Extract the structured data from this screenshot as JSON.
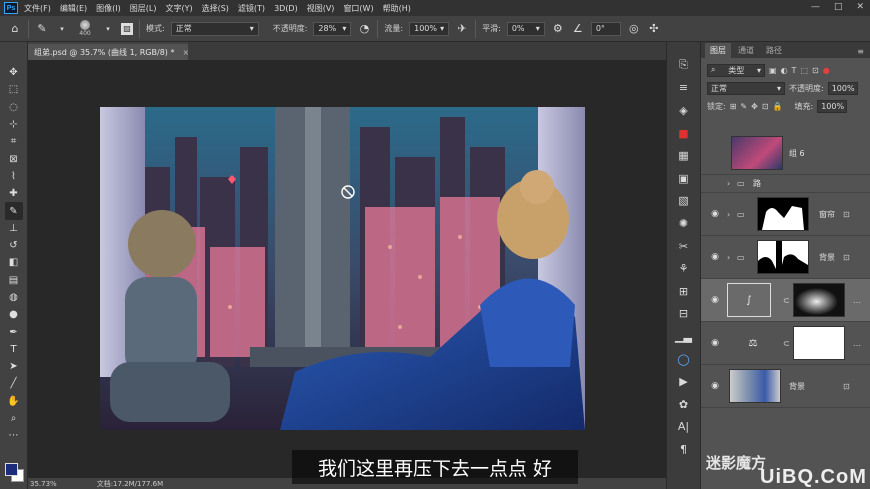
{
  "menu": {
    "logo": "Ps",
    "items": [
      "文件(F)",
      "编辑(E)",
      "图像(I)",
      "图层(L)",
      "文字(Y)",
      "选择(S)",
      "滤镜(T)",
      "3D(D)",
      "视图(V)",
      "窗口(W)",
      "帮助(H)"
    ],
    "window_controls": [
      "—",
      "□",
      "✕"
    ]
  },
  "options": {
    "brush_size": "400",
    "mode_label": "模式:",
    "mode_value": "正常",
    "opacity_label": "不透明度:",
    "opacity_value": "28%",
    "flow_label": "流量:",
    "flow_value": "100%",
    "smooth_label": "平滑:",
    "smooth_value": "0%",
    "angle_value": "0°"
  },
  "document": {
    "tab_title": "组弟.psd @ 35.7% (曲线 1, RGB/8) *",
    "close": "×",
    "zoom": "35.73%",
    "doc_size": "文档:17.2M/177.6M"
  },
  "subtitle": "我们这里再压下去一点点 好",
  "layers_panel": {
    "tabs": [
      "图层",
      "通道",
      "路径"
    ],
    "kind_label": "类型",
    "blend_mode": "正常",
    "opacity_label": "不透明度:",
    "opacity_value": "100%",
    "lock_label": "锁定:",
    "fill_label": "填充:",
    "fill_value": "100%",
    "layers": [
      {
        "name": "组 6"
      },
      {
        "name": "路"
      },
      {
        "name": "窗帘"
      },
      {
        "name": "背景"
      },
      {
        "name": ""
      },
      {
        "name": ""
      },
      {
        "name": "背景"
      }
    ]
  },
  "watermark": {
    "line1": "迷影魔方",
    "line2": "UiBQ.CoM"
  },
  "colors": {
    "foreground": "#1b2c7a",
    "background": "#ffffff"
  }
}
